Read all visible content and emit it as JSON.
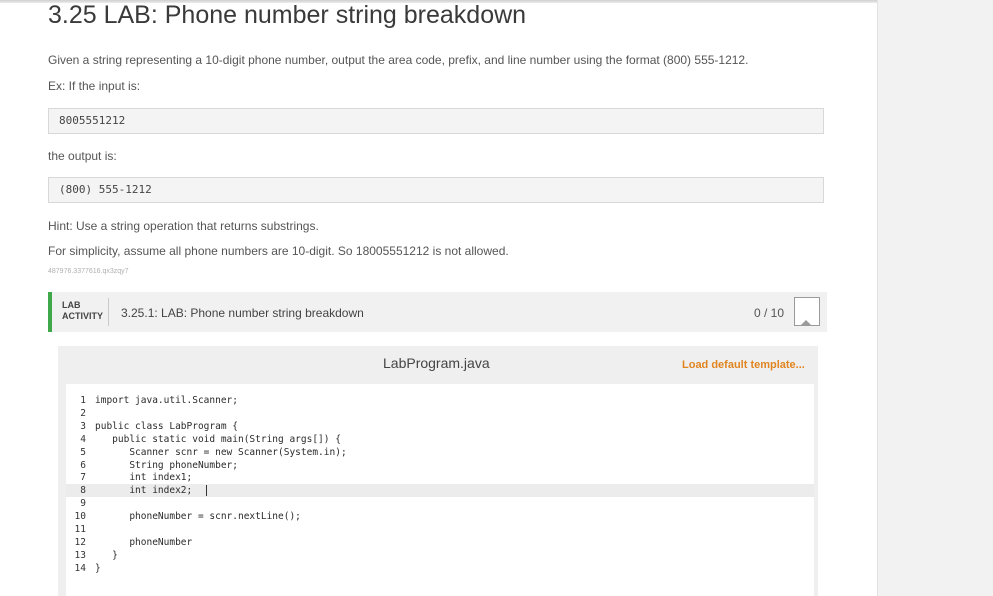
{
  "title": "3.25 LAB: Phone number string breakdown",
  "description": "Given a string representing a 10-digit phone number, output the area code, prefix, and line number using the format (800) 555-1212.",
  "example_intro": "Ex: If the input is:",
  "example_input": "8005551212",
  "output_intro": "the output is:",
  "example_output": "(800) 555-1212",
  "hint": "Hint: Use a string operation that returns substrings.",
  "simplicity_note": "For simplicity, assume all phone numbers are 10-digit. So 18005551212 is not allowed.",
  "activity_id": "487976.3377616.qx3zqy7",
  "lab": {
    "tag_line1": "LAB",
    "tag_line2": "ACTIVITY",
    "title": "3.25.1: LAB: Phone number string breakdown",
    "score": "0 / 10"
  },
  "editor": {
    "file_name": "LabProgram.java",
    "load_template_label": "Load default template...",
    "lines": [
      {
        "num": "1",
        "text": "import java.util.Scanner;"
      },
      {
        "num": "2",
        "text": ""
      },
      {
        "num": "3",
        "text": "public class LabProgram {"
      },
      {
        "num": "4",
        "text": "   public static void main(String args[]) {"
      },
      {
        "num": "5",
        "text": "      Scanner scnr = new Scanner(System.in);"
      },
      {
        "num": "6",
        "text": "      String phoneNumber;"
      },
      {
        "num": "7",
        "text": "      int index1;"
      },
      {
        "num": "8",
        "text": "      int index2;"
      },
      {
        "num": "9",
        "text": ""
      },
      {
        "num": "10",
        "text": "      phoneNumber = scnr.nextLine();"
      },
      {
        "num": "11",
        "text": ""
      },
      {
        "num": "12",
        "text": "      phoneNumber"
      },
      {
        "num": "13",
        "text": "   }"
      },
      {
        "num": "14",
        "text": "}"
      }
    ]
  },
  "colors": {
    "accent_green": "#3fa84a",
    "link_orange": "#e08520"
  }
}
